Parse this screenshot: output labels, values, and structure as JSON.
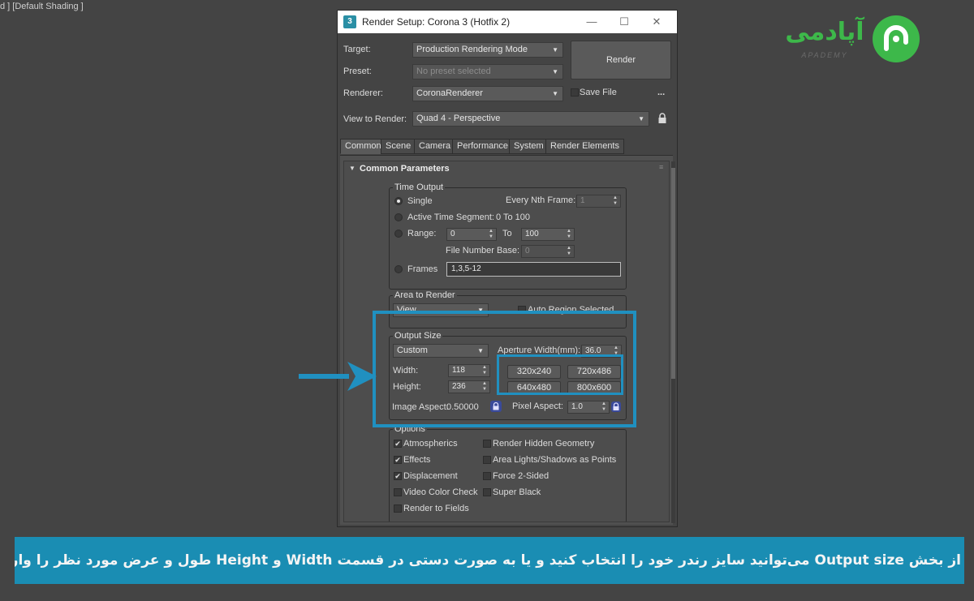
{
  "viewport": {
    "label": "d ] [Default Shading ]"
  },
  "logo": {
    "persian_text": "آپادمی",
    "sub_text": "APADEMY",
    "color": "#3db84a"
  },
  "dialog": {
    "title": "Render Setup: Corona 3 (Hotfix 2)",
    "app_icon": "3",
    "controls": {
      "minimize": "—",
      "maximize": "☐",
      "close": "✕"
    },
    "target": {
      "label": "Target:",
      "value": "Production Rendering Mode"
    },
    "preset": {
      "label": "Preset:",
      "value": "No preset selected"
    },
    "renderer": {
      "label": "Renderer:",
      "value": "CoronaRenderer"
    },
    "save_file_label": "Save File",
    "more": "...",
    "render_button": "Render",
    "view_to_render": {
      "label": "View to Render:",
      "value": "Quad 4 - Perspective"
    },
    "lock_icon": "lock-icon",
    "tabs": [
      "Common",
      "Scene",
      "Camera",
      "Performance",
      "System",
      "Render Elements"
    ],
    "active_tab": "Common",
    "rollout_title": "Common Parameters",
    "time_output": {
      "title": "Time Output",
      "single": "Single",
      "every_nth_label": "Every Nth Frame:",
      "every_nth_value": "1",
      "active_segment_label": "Active Time Segment:",
      "active_segment_value": "0 To 100",
      "range_label": "Range:",
      "range_from": "0",
      "range_to_label": "To",
      "range_to": "100",
      "file_number_base_label": "File Number Base:",
      "file_number_base_value": "0",
      "frames_label": "Frames",
      "frames_value": "1,3,5-12"
    },
    "area_to_render": {
      "title": "Area to Render",
      "value": "View",
      "auto_region_label": "Auto Region Selected"
    },
    "output_size": {
      "title": "Output Size",
      "preset": "Custom",
      "aperture_label": "Aperture Width(mm):",
      "aperture_value": "36.0",
      "width_label": "Width:",
      "width_value": "118",
      "height_label": "Height:",
      "height_value": "236",
      "presets": [
        "320x240",
        "720x486",
        "640x480",
        "800x600"
      ],
      "image_aspect_label": "Image Aspect:",
      "image_aspect_value": "0.50000",
      "pixel_aspect_label": "Pixel Aspect:",
      "pixel_aspect_value": "1.0"
    },
    "options": {
      "title": "Options",
      "left": [
        {
          "label": "Atmospherics",
          "checked": true
        },
        {
          "label": "Effects",
          "checked": true
        },
        {
          "label": "Displacement",
          "checked": true
        },
        {
          "label": "Video Color Check",
          "checked": false
        },
        {
          "label": "Render to Fields",
          "checked": false
        }
      ],
      "right": [
        {
          "label": "Render Hidden Geometry",
          "checked": false
        },
        {
          "label": "Area Lights/Shadows as Points",
          "checked": false
        },
        {
          "label": "Force 2-Sided",
          "checked": false
        },
        {
          "label": "Super Black",
          "checked": false
        }
      ]
    }
  },
  "highlight_color": "#2090c0",
  "caption": "از بخش Output size می‌توانید سایز رندر خود را  انتخاب کنید و یا به صورت دستی در قسمت Width و Height طول و عرض مورد نظر را وارد کنید."
}
